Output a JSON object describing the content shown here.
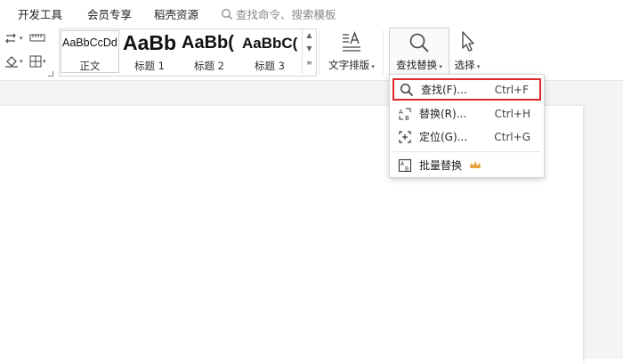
{
  "menubar": {
    "tabs": [
      "开发工具",
      "会员专享",
      "稻壳资源"
    ],
    "search_placeholder": "查找命令、搜索模板"
  },
  "styles": [
    {
      "sample": "AaBbCcDd",
      "label": "正文"
    },
    {
      "sample": "AaBb",
      "label": "标题 1"
    },
    {
      "sample": "AaBb(",
      "label": "标题 2"
    },
    {
      "sample": "AaBbC(",
      "label": "标题 3"
    }
  ],
  "ribbon": {
    "text_layout": "文字排版",
    "find_replace": "查找替换",
    "select": "选择"
  },
  "dropdown": {
    "items": [
      {
        "label": "查找(F)...",
        "shortcut": "Ctrl+F"
      },
      {
        "label": "替换(R)...",
        "shortcut": "Ctrl+H"
      },
      {
        "label": "定位(G)...",
        "shortcut": "Ctrl+G"
      },
      {
        "label": "批量替换",
        "shortcut": ""
      }
    ]
  },
  "colors": {
    "highlight_border": "#e0252b",
    "crown": "#e8a33c"
  }
}
